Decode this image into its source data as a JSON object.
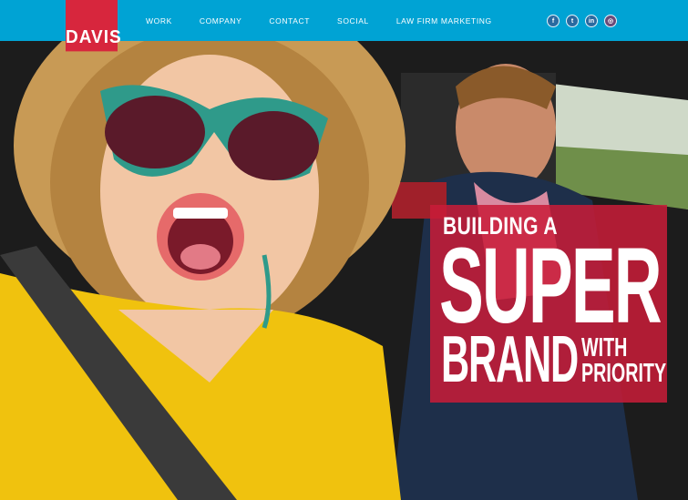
{
  "brand": {
    "logo_text": "DAVIS"
  },
  "nav": {
    "items": [
      {
        "label": "WORK"
      },
      {
        "label": "COMPANY"
      },
      {
        "label": "CONTACT"
      },
      {
        "label": "SOCIAL"
      },
      {
        "label": "LAW FIRM MARKETING"
      }
    ]
  },
  "social": [
    {
      "icon": "facebook-icon",
      "glyph": "f"
    },
    {
      "icon": "twitter-icon",
      "glyph": "t"
    },
    {
      "icon": "linkedin-icon",
      "glyph": "in"
    },
    {
      "icon": "instagram-icon",
      "glyph": "◎"
    }
  ],
  "hero": {
    "line1": "BUILDING A",
    "line2": "SUPER",
    "line3": "BRAND",
    "line4a": "WITH",
    "line4b": "PRIORITY"
  },
  "colors": {
    "header": "#00a3d4",
    "logo": "#d7263d",
    "panel": "#c81c38"
  }
}
